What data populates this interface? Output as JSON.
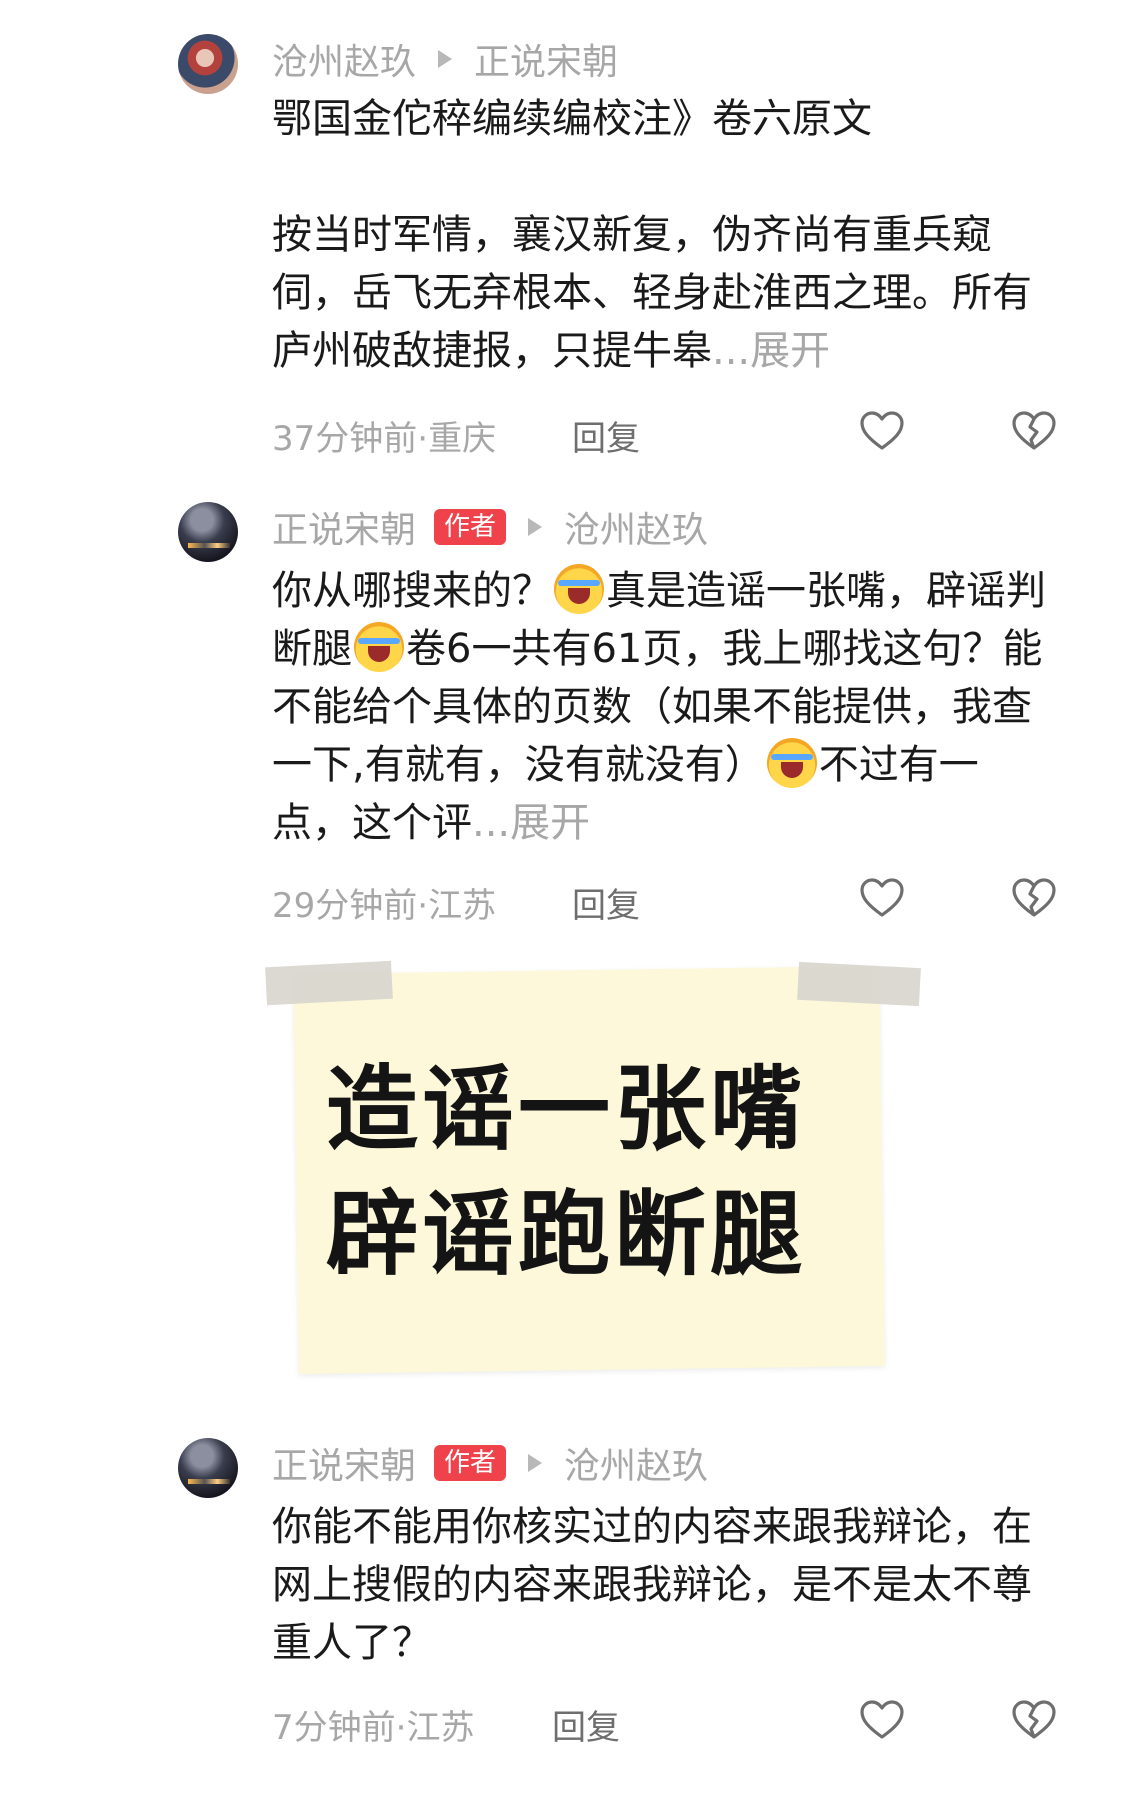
{
  "comments": [
    {
      "author": "沧州赵玖",
      "reply_to": "正说宋朝",
      "is_author": false,
      "text": "鄂国金佗稡编续编校注》卷六原文\n\n按当时军情，襄汉新复，伪齐尚有重兵窥伺，岳飞无弃根本、轻身赴淮西之理。所有庐州破敌捷报，只提牛皋",
      "expand_label": "...展开",
      "time_location": "37分钟前·重庆",
      "reply_label": "回复"
    },
    {
      "author": "正说宋朝",
      "badge": "作者",
      "reply_to": "沧州赵玖",
      "is_author": true,
      "text_parts": [
        "你从哪搜来的？",
        "真是造谣一张嘴，辟谣判断腿",
        "卷6一共有61页，我上哪找这句？能不能给个具体的页数（如果不能提供，我查一下,有就有，没有就没有）",
        "不过有一点，这个评"
      ],
      "expand_label": "...展开",
      "time_location": "29分钟前·江苏",
      "reply_label": "回复"
    },
    {
      "author": "正说宋朝",
      "badge": "作者",
      "reply_to": "沧州赵玖",
      "is_author": true,
      "text": "你能不能用你核实过的内容来跟我辩论，在网上搜假的内容来跟我辩论，是不是太不尊重人了？",
      "time_location": "7分钟前·江苏",
      "reply_label": "回复"
    }
  ],
  "sticky_note": {
    "line1": "造谣一张嘴",
    "line2": "辟谣跑断腿"
  },
  "colors": {
    "meta_gray": "#a7a7a7",
    "badge_red": "#f0424b",
    "note_yellow": "#fcf8d9"
  }
}
